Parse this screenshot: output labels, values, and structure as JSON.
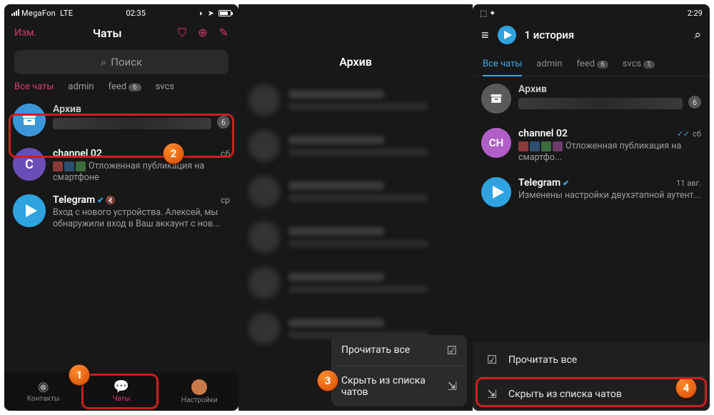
{
  "p1": {
    "status": {
      "carrier": "MegaFon",
      "net": "LTE",
      "time": "02:35"
    },
    "header": {
      "edit": "Изм.",
      "title": "Чаты"
    },
    "search_ph": "Поиск",
    "tabs": [
      {
        "label": "Все чаты",
        "active": true
      },
      {
        "label": "admin"
      },
      {
        "label": "feed",
        "badge": "6"
      },
      {
        "label": "svcs"
      }
    ],
    "chats": {
      "archive": {
        "name": "Архив",
        "count": "6"
      },
      "c1": {
        "name": "channel 02",
        "time": "сб",
        "msg": "Отложенная публикация на смартфоне"
      },
      "c2": {
        "name": "Telegram",
        "time": "ср",
        "msg": "Вход с нового устройства. Алексей, мы обнаружили вход в Ваш аккаунт с нов..."
      }
    },
    "tabbar": {
      "contacts": "Контакты",
      "chats": "Чаты",
      "settings": "Настройки"
    }
  },
  "p2": {
    "title": "Архив",
    "menu": {
      "read": "Прочитать все",
      "hide": "Скрыть из списка\nчатов"
    }
  },
  "p3": {
    "status_time": "2:29",
    "header_title": "1 история",
    "tabs": [
      {
        "label": "Все чаты",
        "active": true
      },
      {
        "label": "admin"
      },
      {
        "label": "feed",
        "badge": "6"
      },
      {
        "label": "svcs",
        "badge": "1"
      }
    ],
    "chats": {
      "archive": {
        "name": "Архив",
        "count": "6"
      },
      "c1": {
        "name": "channel 02",
        "time": "сб",
        "msg": "Отложенная публикация на смартфо..."
      },
      "c2": {
        "name": "Telegram",
        "time": "11 авг.",
        "msg": "Изменены настройки двухэтапной аутент..."
      }
    },
    "menu": {
      "read": "Прочитать все",
      "hide": "Скрыть из списка чатов"
    }
  },
  "steps": {
    "s1": "1",
    "s2": "2",
    "s3": "3",
    "s4": "4"
  }
}
